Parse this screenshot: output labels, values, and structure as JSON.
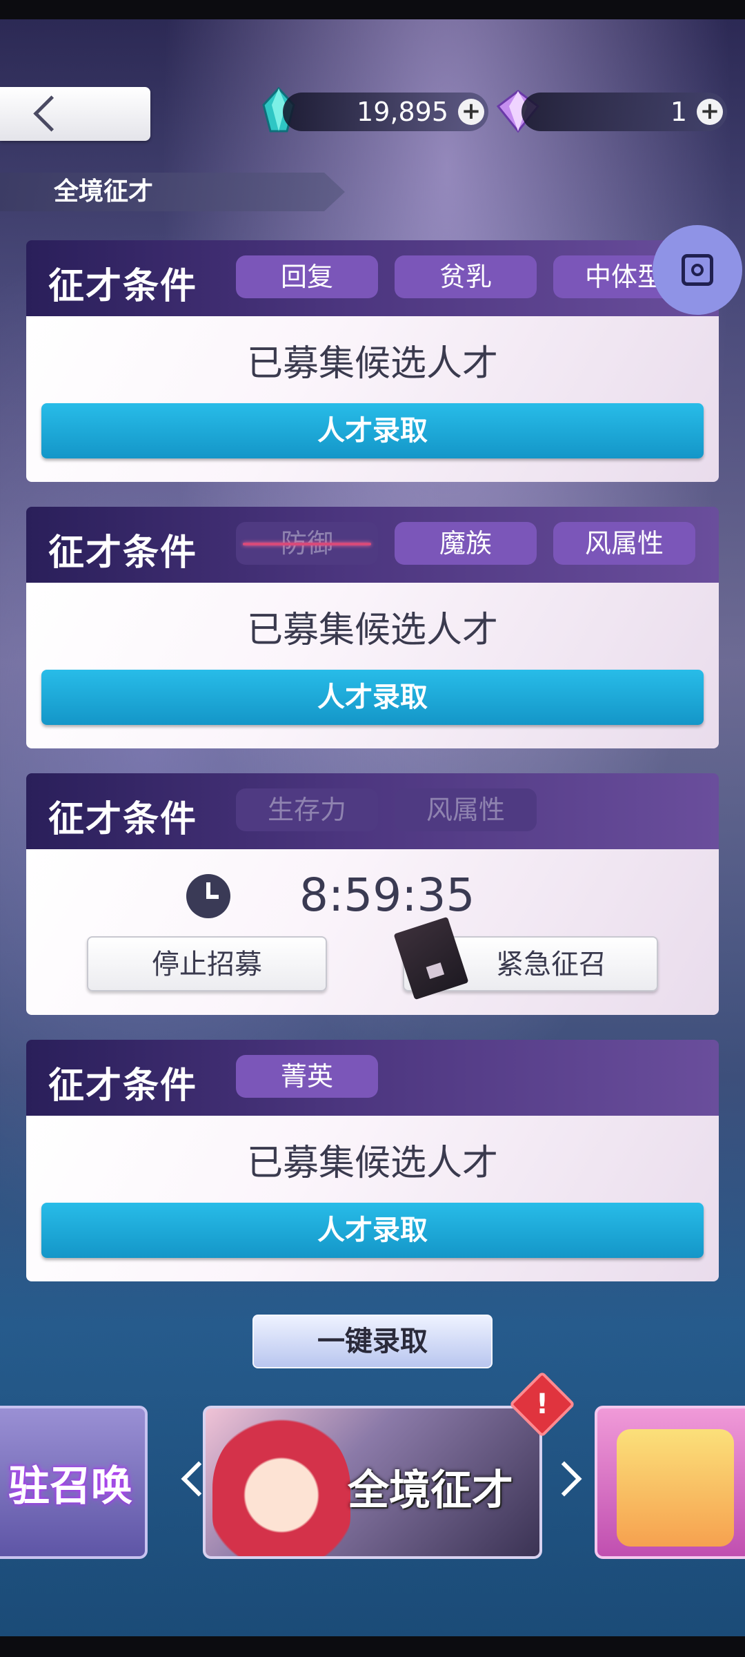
{
  "header": {
    "currency_1": {
      "amount": "19,895",
      "icon": "blue-crystal-icon"
    },
    "currency_2": {
      "amount": "1",
      "icon": "purple-diamond-icon"
    },
    "plus": "+",
    "section_title": "全境征才"
  },
  "cards": [
    {
      "title": "征才条件",
      "tags": [
        "回复",
        "贫乳",
        "中体型"
      ],
      "status": "已募集候选人才",
      "button": "人才录取"
    },
    {
      "title": "征才条件",
      "tags": [
        "防御",
        "魔族",
        "风属性"
      ],
      "status": "已募集候选人才",
      "button": "人才录取"
    },
    {
      "title": "征才条件",
      "tags": [
        "生存力",
        "风属性"
      ],
      "timer": "8:59:35",
      "stop_button": "停止招募",
      "urgent_button": "紧急征召"
    },
    {
      "title": "征才条件",
      "tags": [
        "菁英"
      ],
      "status": "已募集候选人才",
      "button": "人才录取"
    }
  ],
  "one_click": "一键录取",
  "banners": {
    "left": "驻召唤",
    "center": "全境征才",
    "alert": "!"
  },
  "colors": {
    "primary_button": "#1fa8d8",
    "tag": "#7b56b9",
    "card_header": "#4b357e"
  }
}
